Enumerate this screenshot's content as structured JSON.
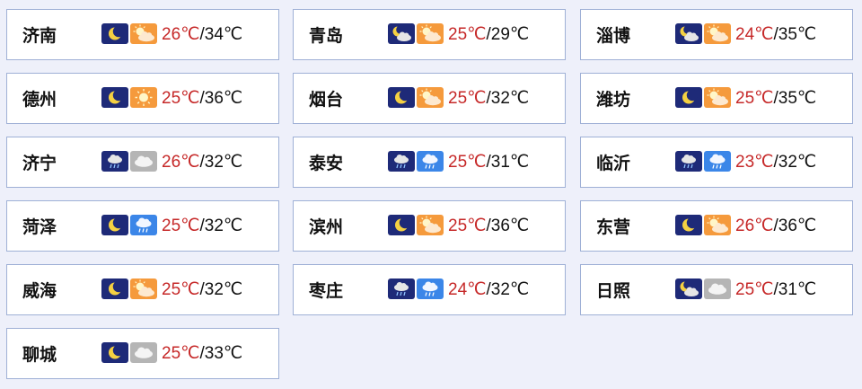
{
  "weather_cards": [
    {
      "city": "济南",
      "night_icon": "moon-icon",
      "day_icon": "partly-sunny-icon",
      "low": "26℃",
      "high": "34℃"
    },
    {
      "city": "青岛",
      "night_icon": "moon-cloud-icon",
      "day_icon": "partly-sunny-icon",
      "low": "25℃",
      "high": "29℃"
    },
    {
      "city": "淄博",
      "night_icon": "moon-cloud-icon",
      "day_icon": "partly-sunny-icon",
      "low": "24℃",
      "high": "35℃"
    },
    {
      "city": "德州",
      "night_icon": "moon-icon",
      "day_icon": "sunny-icon",
      "low": "25℃",
      "high": "36℃"
    },
    {
      "city": "烟台",
      "night_icon": "moon-icon",
      "day_icon": "partly-sunny-icon",
      "low": "25℃",
      "high": "32℃"
    },
    {
      "city": "潍坊",
      "night_icon": "moon-icon",
      "day_icon": "partly-sunny-icon",
      "low": "25℃",
      "high": "35℃"
    },
    {
      "city": "济宁",
      "night_icon": "night-rain-icon",
      "day_icon": "cloudy-icon",
      "low": "26℃",
      "high": "32℃"
    },
    {
      "city": "泰安",
      "night_icon": "night-rain-icon",
      "day_icon": "rain-icon",
      "low": "25℃",
      "high": "31℃"
    },
    {
      "city": "临沂",
      "night_icon": "night-rain-icon",
      "day_icon": "rain-icon",
      "low": "23℃",
      "high": "32℃"
    },
    {
      "city": "菏泽",
      "night_icon": "moon-icon",
      "day_icon": "rain-icon",
      "low": "25℃",
      "high": "32℃"
    },
    {
      "city": "滨州",
      "night_icon": "moon-icon",
      "day_icon": "partly-sunny-icon",
      "low": "25℃",
      "high": "36℃"
    },
    {
      "city": "东营",
      "night_icon": "moon-icon",
      "day_icon": "partly-sunny-icon",
      "low": "26℃",
      "high": "36℃"
    },
    {
      "city": "威海",
      "night_icon": "moon-icon",
      "day_icon": "partly-sunny-icon",
      "low": "25℃",
      "high": "32℃"
    },
    {
      "city": "枣庄",
      "night_icon": "night-rain-icon",
      "day_icon": "rain-icon",
      "low": "24℃",
      "high": "32℃"
    },
    {
      "city": "日照",
      "night_icon": "moon-cloud-icon",
      "day_icon": "cloudy-icon",
      "low": "25℃",
      "high": "31℃"
    },
    {
      "city": "聊城",
      "night_icon": "moon-icon",
      "day_icon": "cloudy-icon",
      "low": "25℃",
      "high": "33℃"
    }
  ],
  "colors": {
    "background": "#eef0fa",
    "card_border": "#9fb0d6",
    "low_temp": "#c62828",
    "night_icon_bg": "#1e2a78",
    "sunny_icon_bg": "#f59a3c",
    "rain_icon_bg": "#3b86e8",
    "cloudy_icon_bg": "#b5b5b5"
  }
}
